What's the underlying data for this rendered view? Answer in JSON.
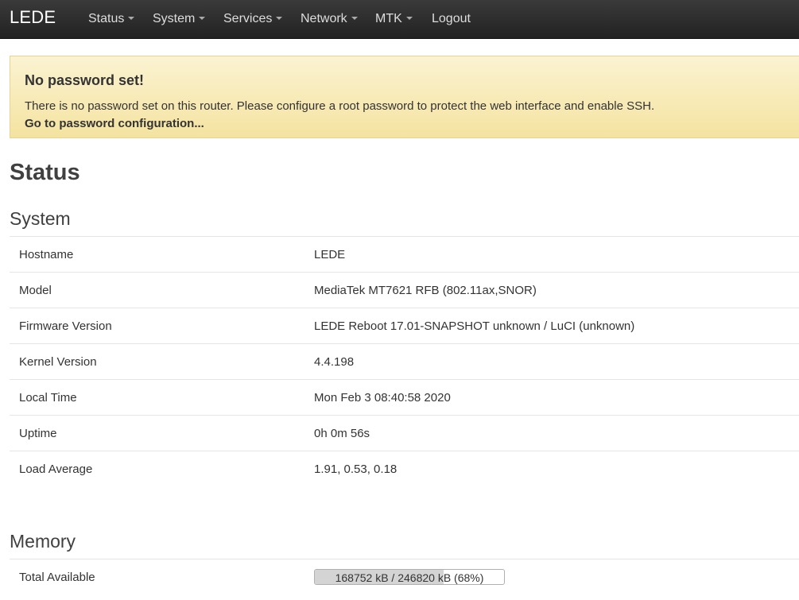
{
  "navbar": {
    "brand": "LEDE",
    "items": [
      {
        "label": "Status",
        "dropdown": true
      },
      {
        "label": "System",
        "dropdown": true
      },
      {
        "label": "Services",
        "dropdown": true
      },
      {
        "label": "Network",
        "dropdown": true
      },
      {
        "label": "MTK",
        "dropdown": true
      },
      {
        "label": "Logout",
        "dropdown": false
      }
    ]
  },
  "alert": {
    "title": "No password set!",
    "text": "There is no password set on this router. Please configure a root password to protect the web interface and enable SSH.",
    "link": "Go to password configuration..."
  },
  "page": {
    "title": "Status"
  },
  "system": {
    "title": "System",
    "rows": [
      {
        "label": "Hostname",
        "value": "LEDE"
      },
      {
        "label": "Model",
        "value": "MediaTek MT7621 RFB (802.11ax,SNOR)"
      },
      {
        "label": "Firmware Version",
        "value": "LEDE Reboot 17.01-SNAPSHOT unknown / LuCI (unknown)"
      },
      {
        "label": "Kernel Version",
        "value": "4.4.198"
      },
      {
        "label": "Local Time",
        "value": "Mon Feb 3 08:40:58 2020"
      },
      {
        "label": "Uptime",
        "value": "0h 0m 56s"
      },
      {
        "label": "Load Average",
        "value": "1.91, 0.53, 0.18"
      }
    ]
  },
  "memory": {
    "title": "Memory",
    "rows": [
      {
        "label": "Total Available",
        "value": "168752 kB / 246820 kB (68%)",
        "fraction": 0.68
      }
    ]
  },
  "colors": {
    "navbar": "#222222",
    "alert_bg": "#f4e3a0",
    "progress_fill": "#d4d4d4"
  }
}
